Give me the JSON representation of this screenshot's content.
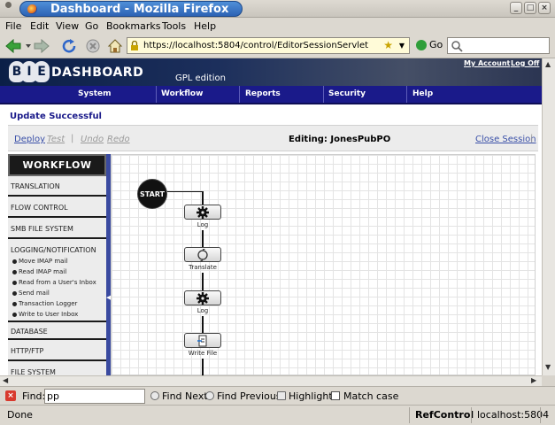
{
  "window": {
    "title": "Dashboard - Mozilla Firefox",
    "controls": [
      "_",
      "□",
      "×"
    ]
  },
  "menu": [
    "File",
    "Edit",
    "View",
    "Go",
    "Bookmarks",
    "Tools",
    "Help"
  ],
  "toolbar": {
    "url": "https://localhost:5804/control/EditorSessionServlet",
    "go_label": "Go"
  },
  "site": {
    "logo_letters": [
      "B",
      "I",
      "E"
    ],
    "title": "DASHBOARD",
    "edition": "GPL edition",
    "links": [
      "My Account",
      "Log Off"
    ],
    "nav": [
      "System",
      "Workflow",
      "Reports",
      "Security",
      "Help"
    ]
  },
  "status_message": "Update Successful",
  "editor": {
    "deploy": "Deploy",
    "test": "Test",
    "undo": "Undo",
    "redo": "Redo",
    "editing": "Editing: JonesPubPO",
    "close_session": "Close Session"
  },
  "palette": {
    "header": "WORKFLOW",
    "categories": [
      "TRANSLATION",
      "FLOW CONTROL",
      "SMB FILE SYSTEM",
      "LOGGING/NOTIFICATION",
      "DATABASE",
      "HTTP/FTP",
      "FILE SYSTEM"
    ],
    "logging_items": [
      "Move IMAP mail",
      "Read IMAP mail",
      "Read from a User's Inbox",
      "Send mail",
      "Transaction Logger",
      "Write to User Inbox"
    ]
  },
  "workflow": {
    "start_label": "START",
    "tasks": [
      {
        "label": "Log",
        "icon": "gear-icon"
      },
      {
        "label": "Translate",
        "icon": "cycle-icon"
      },
      {
        "label": "Log",
        "icon": "gear-icon"
      },
      {
        "label": "Write File",
        "icon": "file-icon"
      }
    ]
  },
  "findbar": {
    "label": "Find:",
    "value": "pp",
    "find_next": "Find Next",
    "find_previous": "Find Previous",
    "highlight": "Highlight",
    "match_case": "Match case"
  },
  "statusbar": {
    "text": "Done",
    "addon": "RefControl",
    "host": "localhost:5804"
  }
}
